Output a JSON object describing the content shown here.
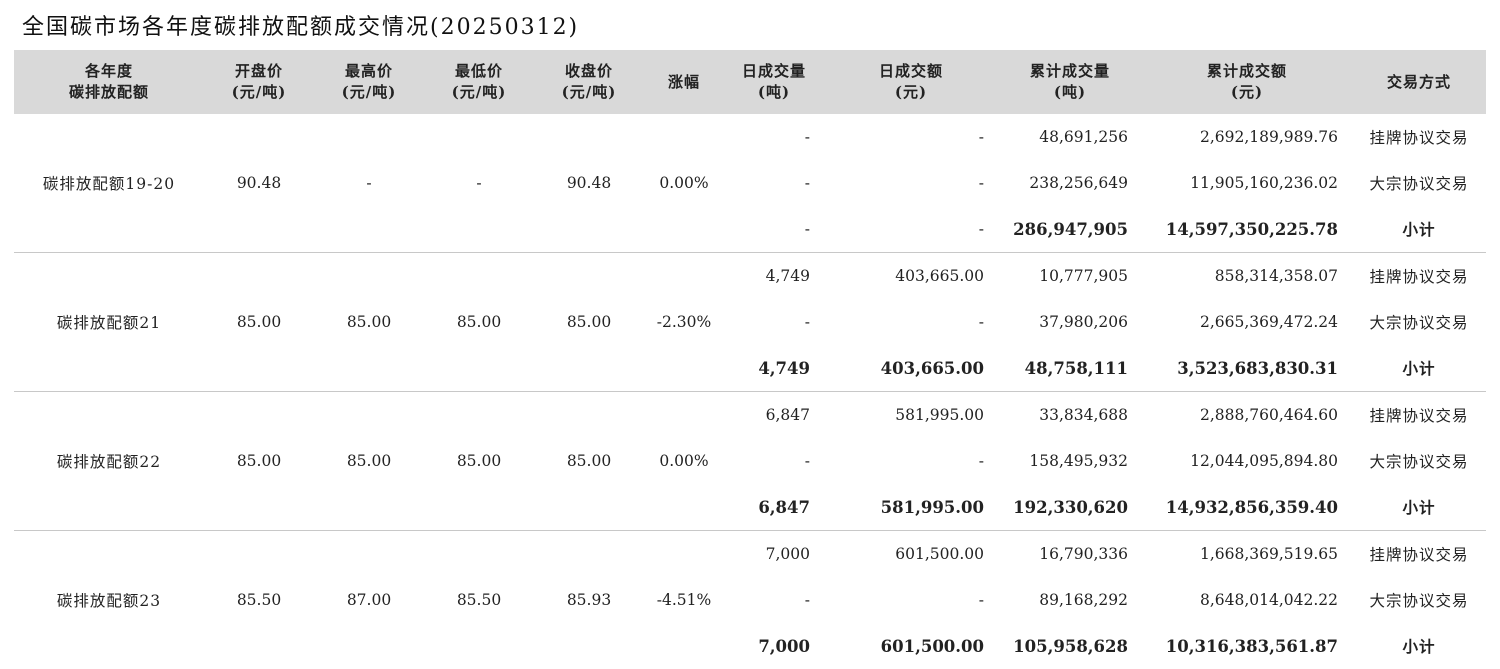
{
  "title": "全国碳市场各年度碳排放配额成交情况(20250312)",
  "headers": [
    {
      "l1": "各年度",
      "l2": "碳排放配额"
    },
    {
      "l1": "开盘价",
      "l2": "(元/吨)"
    },
    {
      "l1": "最高价",
      "l2": "(元/吨)"
    },
    {
      "l1": "最低价",
      "l2": "(元/吨)"
    },
    {
      "l1": "收盘价",
      "l2": "(元/吨)"
    },
    {
      "l1": "涨幅",
      "l2": ""
    },
    {
      "l1": "日成交量",
      "l2": "(吨)"
    },
    {
      "l1": "日成交额",
      "l2": "(元)"
    },
    {
      "l1": "累计成交量",
      "l2": "(吨)"
    },
    {
      "l1": "累计成交额",
      "l2": "(元)"
    },
    {
      "l1": "交易方式",
      "l2": ""
    }
  ],
  "groups": [
    {
      "name": "碳排放配额19-20",
      "open": "90.48",
      "high": "-",
      "low": "-",
      "close": "90.48",
      "change": "0.00%",
      "rows": [
        {
          "daily_vol": "-",
          "daily_amt": "-",
          "cum_vol": "48,691,256",
          "cum_amt": "2,692,189,989.76",
          "method": "挂牌协议交易"
        },
        {
          "daily_vol": "-",
          "daily_amt": "-",
          "cum_vol": "238,256,649",
          "cum_amt": "11,905,160,236.02",
          "method": "大宗协议交易"
        },
        {
          "daily_vol": "-",
          "daily_amt": "-",
          "cum_vol": "286,947,905",
          "cum_amt": "14,597,350,225.78",
          "method": "小计"
        }
      ]
    },
    {
      "name": "碳排放配额21",
      "open": "85.00",
      "high": "85.00",
      "low": "85.00",
      "close": "85.00",
      "change": "-2.30%",
      "rows": [
        {
          "daily_vol": "4,749",
          "daily_amt": "403,665.00",
          "cum_vol": "10,777,905",
          "cum_amt": "858,314,358.07",
          "method": "挂牌协议交易"
        },
        {
          "daily_vol": "-",
          "daily_amt": "-",
          "cum_vol": "37,980,206",
          "cum_amt": "2,665,369,472.24",
          "method": "大宗协议交易"
        },
        {
          "daily_vol": "4,749",
          "daily_amt": "403,665.00",
          "cum_vol": "48,758,111",
          "cum_amt": "3,523,683,830.31",
          "method": "小计"
        }
      ]
    },
    {
      "name": "碳排放配额22",
      "open": "85.00",
      "high": "85.00",
      "low": "85.00",
      "close": "85.00",
      "change": "0.00%",
      "rows": [
        {
          "daily_vol": "6,847",
          "daily_amt": "581,995.00",
          "cum_vol": "33,834,688",
          "cum_amt": "2,888,760,464.60",
          "method": "挂牌协议交易"
        },
        {
          "daily_vol": "-",
          "daily_amt": "-",
          "cum_vol": "158,495,932",
          "cum_amt": "12,044,095,894.80",
          "method": "大宗协议交易"
        },
        {
          "daily_vol": "6,847",
          "daily_amt": "581,995.00",
          "cum_vol": "192,330,620",
          "cum_amt": "14,932,856,359.40",
          "method": "小计"
        }
      ]
    },
    {
      "name": "碳排放配额23",
      "open": "85.50",
      "high": "87.00",
      "low": "85.50",
      "close": "85.93",
      "change": "-4.51%",
      "rows": [
        {
          "daily_vol": "7,000",
          "daily_amt": "601,500.00",
          "cum_vol": "16,790,336",
          "cum_amt": "1,668,369,519.65",
          "method": "挂牌协议交易"
        },
        {
          "daily_vol": "-",
          "daily_amt": "-",
          "cum_vol": "89,168,292",
          "cum_amt": "8,648,014,042.22",
          "method": "大宗协议交易"
        },
        {
          "daily_vol": "7,000",
          "daily_amt": "601,500.00",
          "cum_vol": "105,958,628",
          "cum_amt": "10,316,383,561.87",
          "method": "小计"
        }
      ]
    }
  ]
}
